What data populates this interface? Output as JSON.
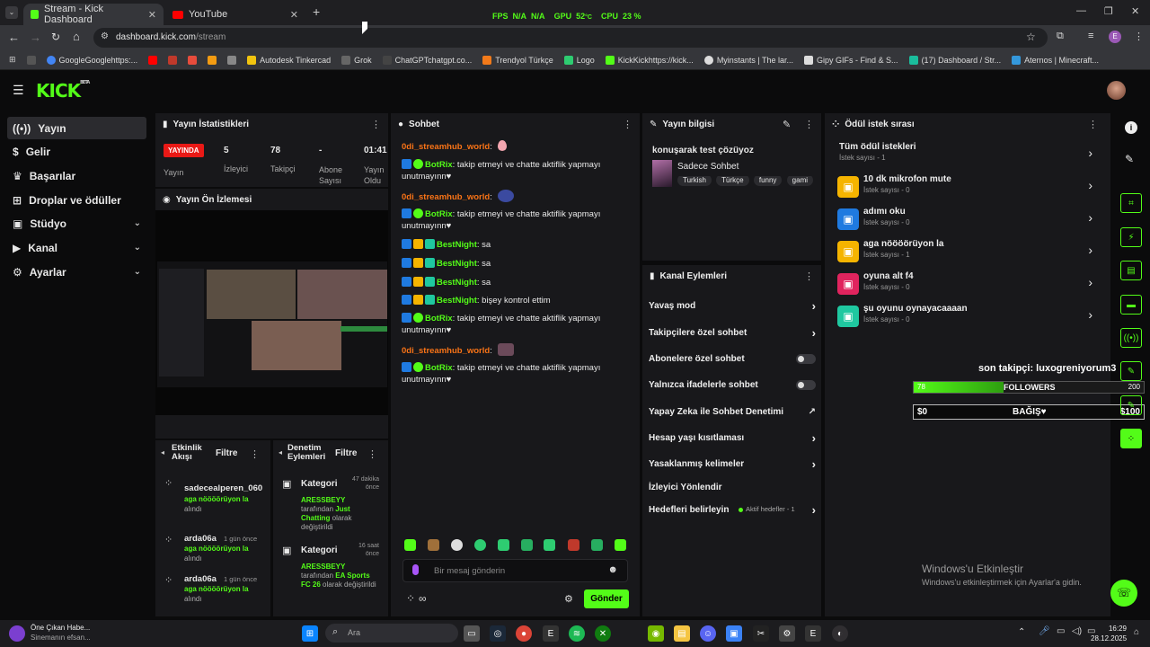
{
  "browser": {
    "tabs": [
      {
        "title": "Stream - Kick Dashboard",
        "active": true
      },
      {
        "title": "YouTube",
        "active": false
      }
    ],
    "url": "dashboard.kick.com",
    "url_path": "/stream",
    "perf": {
      "fps_label": "FPS",
      "fps_value": "N/A",
      "fps_value2": "N/A",
      "gpu_label": "GPU",
      "gpu_value": "52",
      "gpu_unit": "°C",
      "cpu_label": "CPU",
      "cpu_value": "23",
      "cpu_unit": "%"
    },
    "bookmarks": [
      "GoogleGooglehttps:...",
      "Autodesk Tinkercad",
      "Grok",
      "ChatGPTchatgpt.co...",
      "Trendyol Türkçe",
      "Logo",
      "KickKickhttps://kick...",
      "Myinstants | The lar...",
      "Gipy GIFs - Find & S...",
      "(17) Dashboard / Str...",
      "Aternos | Minecraft..."
    ]
  },
  "kick": {
    "logo": "KICK",
    "logo_sup": "BETA",
    "accent": "#53fc18"
  },
  "sidebar": {
    "items": [
      {
        "label": "Yayın",
        "icon": "broadcast-icon",
        "active": true
      },
      {
        "label": "Gelir",
        "icon": "dollar-icon"
      },
      {
        "label": "Başarılar",
        "icon": "trophy-icon"
      },
      {
        "label": "Droplar ve ödüller",
        "icon": "gift-icon"
      },
      {
        "label": "Stüdyo",
        "icon": "studio-icon",
        "expandable": true
      },
      {
        "label": "Kanal",
        "icon": "channel-icon",
        "expandable": true
      },
      {
        "label": "Ayarlar",
        "icon": "gear-icon",
        "expandable": true
      }
    ]
  },
  "stats": {
    "title": "Yayın İstatistikleri",
    "live_badge": "YAYINDA",
    "live_label": "Yayın",
    "viewers_value": "5",
    "viewers_label": "İzleyici",
    "followers_value": "78",
    "followers_label": "Takipçi",
    "subs_value": "-",
    "subs_label": "Abone Sayısı",
    "time_value": "01:41",
    "time_label": "Yayın Oldu"
  },
  "preview": {
    "title": "Yayın Ön İzlemesi"
  },
  "activity": {
    "title": "Etkinlik Akışı",
    "filter": "Filtre",
    "items": [
      {
        "user": "sadecealperen_060",
        "time": "",
        "action": "aga nöööörüyon la",
        "suffix": "alındı"
      },
      {
        "user": "arda06a",
        "time": "1 gün önce",
        "action": "aga nöööörüyon la",
        "suffix": "alındı"
      },
      {
        "user": "arda06a",
        "time": "1 gün önce",
        "action": "aga nöööörüyon la",
        "suffix": "alındı"
      }
    ]
  },
  "moderation": {
    "title": "Denetim Eylemleri",
    "filter": "Filtre",
    "items": [
      {
        "label": "Kategori",
        "time": "47 dakika önce",
        "user": "ARESSBEYY",
        "by": "tarafından",
        "category": "Just Chatting",
        "suffix": "olarak değiştirildi"
      },
      {
        "label": "Kategori",
        "time": "16 saat önce",
        "user": "ARESSBEYY",
        "by": "tarafından",
        "category": "EA Sports FC 26",
        "suffix": "olarak değiştirildi"
      }
    ]
  },
  "chat": {
    "title": "Sohbet",
    "messages": [
      {
        "user": "0di_streamhub_world",
        "text": ":",
        "color": "#f97316"
      },
      {
        "user": "BotRix",
        "text": ": takip etmeyi ve chatte aktiflik yapmayı unutmayınn♥",
        "color": "#53fc18"
      },
      {
        "user": "0di_streamhub_world",
        "text": ":",
        "color": "#f97316"
      },
      {
        "user": "BotRix",
        "text": ": takip etmeyi ve chatte aktiflik yapmayı unutmayınn♥",
        "color": "#53fc18"
      },
      {
        "user": "BestNight",
        "text": ": sa",
        "color": "#53fc18"
      },
      {
        "user": "BestNight",
        "text": ": sa",
        "color": "#53fc18"
      },
      {
        "user": "BestNight",
        "text": ": sa",
        "color": "#53fc18"
      },
      {
        "user": "BestNight",
        "text": ": bişey kontrol ettim",
        "color": "#53fc18"
      },
      {
        "user": "BotRix",
        "text": ": takip etmeyi ve chatte aktiflik yapmayı unutmayınn♥",
        "color": "#53fc18"
      },
      {
        "user": "0di_streamhub_world",
        "text": ":",
        "color": "#f97316"
      },
      {
        "user": "BotRix",
        "text": ": takip etmeyi ve chatte aktiflik yapmayı unutmayınn♥",
        "color": "#53fc18"
      }
    ],
    "placeholder": "Bir mesaj gönderin",
    "send": "Gönder"
  },
  "streaminfo": {
    "title": "Yayın bilgisi",
    "stream_title": "konuşarak test çözüyoz",
    "category": "Sadece Sohbet",
    "tags": [
      "Turkish",
      "Türkçe",
      "funny",
      "gami"
    ]
  },
  "channel_actions": {
    "title": "Kanal Eylemleri",
    "rows": [
      {
        "label": "Yavaş mod",
        "type": "arrow"
      },
      {
        "label": "Takipçilere özel sohbet",
        "type": "arrow"
      },
      {
        "label": "Abonelere özel sohbet",
        "type": "toggle"
      },
      {
        "label": "Yalnızca ifadelerle sohbet",
        "type": "toggle"
      },
      {
        "label": "Yapay Zeka ile Sohbet Denetimi",
        "type": "external"
      },
      {
        "label": "Hesap yaşı kısıtlaması",
        "type": "arrow"
      },
      {
        "label": "Yasaklanmış kelimeler",
        "type": "arrow"
      },
      {
        "label": "İzleyici Yönlendir",
        "type": "none"
      },
      {
        "label": "Hedefleri belirleyin",
        "type": "arrow",
        "extra": "Aktif hedefler - 1"
      }
    ]
  },
  "rewards": {
    "title": "Ödül istek sırası",
    "all_label": "Tüm ödül istekleri",
    "all_count": "İstek sayısı - 1",
    "items": [
      {
        "title": "10 dk mikrofon mute",
        "count": "İstek sayısı - 0",
        "color": "#f5b400"
      },
      {
        "title": "adımı oku",
        "count": "İstek sayısı - 0",
        "color": "#1f7ae0"
      },
      {
        "title": "aga nöööörüyon la",
        "count": "İstek sayısı - 1",
        "color": "#f5b400"
      },
      {
        "title": "oyuna alt f4",
        "count": "İstek sayısı - 0",
        "color": "#e0245e"
      },
      {
        "title": "şu oyunu oynayacaaaan",
        "count": "İstek sayısı - 0",
        "color": "#1fc8a0"
      }
    ]
  },
  "overlay": {
    "last_follower": "son takipçi: luxogreniyorum3",
    "followers_goal_label": "FOLLOWERS",
    "followers_current": "78",
    "followers_target": "200",
    "followers_progress": 0.39,
    "donation_label": "BAĞIŞ♥",
    "donation_current": "$0",
    "donation_target": "$100"
  },
  "watermark": {
    "line1": "Windows'u Etkinleştir",
    "line2": "Windows'u etkinleştirmek için Ayarlar'a gidin."
  },
  "taskbar": {
    "news_title": "Öne Çıkan Habe...",
    "news_sub": "Sinemanın efsan...",
    "search": "Ara",
    "time": "16:29",
    "date": "28.12.2025"
  }
}
